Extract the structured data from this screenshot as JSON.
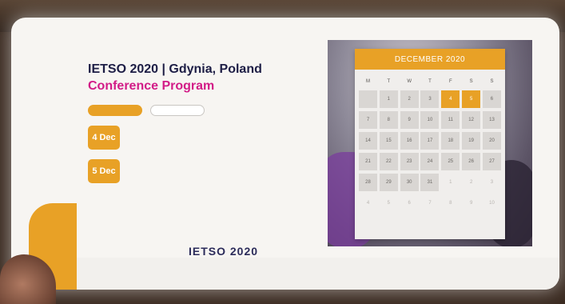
{
  "page": {
    "kicker": "",
    "title": "IETSO 2020 | Gdynia, Poland",
    "subtitle": "Conference Program",
    "description": "",
    "btn_learn": "",
    "btn_contact": "",
    "days": [
      {
        "label": "4 Dec",
        "text": ""
      },
      {
        "label": "5 Dec",
        "text": ""
      }
    ],
    "logo": "IETSO 2020"
  },
  "calendar": {
    "month_title": "DECEMBER 2020",
    "weekdays": [
      "M",
      "T",
      "W",
      "T",
      "F",
      "S",
      "S"
    ],
    "weeks": [
      [
        {
          "d": "",
          "s": "in"
        },
        {
          "d": "1",
          "s": "in"
        },
        {
          "d": "2",
          "s": "in"
        },
        {
          "d": "3",
          "s": "in"
        },
        {
          "d": "4",
          "s": "hl"
        },
        {
          "d": "5",
          "s": "hl"
        },
        {
          "d": "6",
          "s": "in"
        }
      ],
      [
        {
          "d": "7",
          "s": "in"
        },
        {
          "d": "8",
          "s": "in"
        },
        {
          "d": "9",
          "s": "in"
        },
        {
          "d": "10",
          "s": "in"
        },
        {
          "d": "11",
          "s": "in"
        },
        {
          "d": "12",
          "s": "in"
        },
        {
          "d": "13",
          "s": "in"
        }
      ],
      [
        {
          "d": "14",
          "s": "in"
        },
        {
          "d": "15",
          "s": "in"
        },
        {
          "d": "16",
          "s": "in"
        },
        {
          "d": "17",
          "s": "in"
        },
        {
          "d": "18",
          "s": "in"
        },
        {
          "d": "19",
          "s": "in"
        },
        {
          "d": "20",
          "s": "in"
        }
      ],
      [
        {
          "d": "21",
          "s": "in"
        },
        {
          "d": "22",
          "s": "in"
        },
        {
          "d": "23",
          "s": "in"
        },
        {
          "d": "24",
          "s": "in"
        },
        {
          "d": "25",
          "s": "in"
        },
        {
          "d": "26",
          "s": "in"
        },
        {
          "d": "27",
          "s": "in"
        }
      ],
      [
        {
          "d": "28",
          "s": "in"
        },
        {
          "d": "29",
          "s": "in"
        },
        {
          "d": "30",
          "s": "in"
        },
        {
          "d": "31",
          "s": "in"
        },
        {
          "d": "1",
          "s": "out"
        },
        {
          "d": "2",
          "s": "out"
        },
        {
          "d": "3",
          "s": "out"
        }
      ],
      [
        {
          "d": "4",
          "s": "out"
        },
        {
          "d": "5",
          "s": "out"
        },
        {
          "d": "6",
          "s": "out"
        },
        {
          "d": "7",
          "s": "out"
        },
        {
          "d": "8",
          "s": "out"
        },
        {
          "d": "9",
          "s": "out"
        },
        {
          "d": "10",
          "s": "out"
        }
      ]
    ]
  },
  "colors": {
    "accent": "#e8a126",
    "title": "#1d1d45",
    "subtitle": "#d21c87"
  }
}
